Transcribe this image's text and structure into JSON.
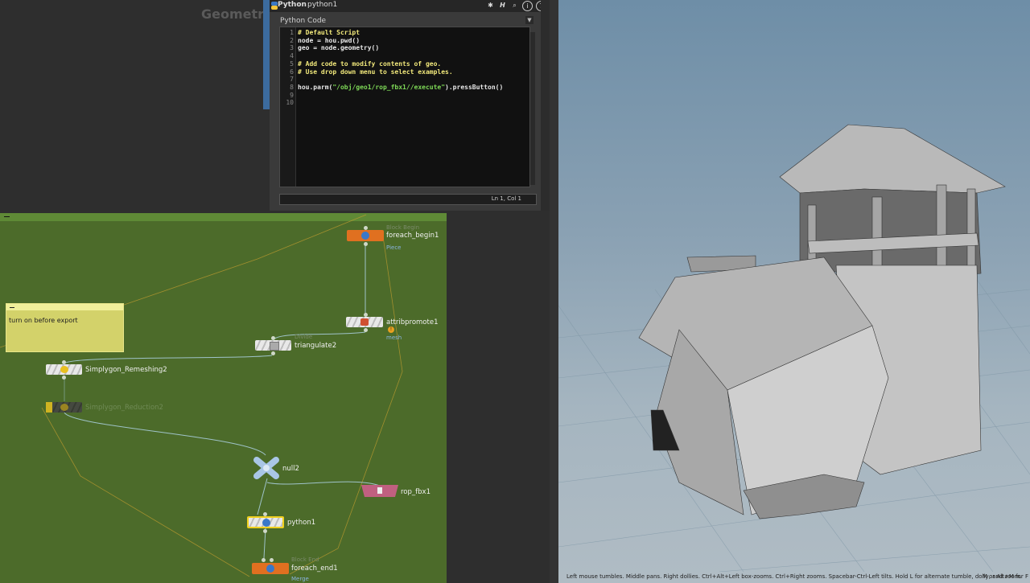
{
  "left_top": {
    "title": "Geometry"
  },
  "python_panel": {
    "tab_label": "Python",
    "node_name": "python1",
    "code_label": "Python Code",
    "lines": [
      {
        "n": "1",
        "text": "# Default Script",
        "kind": "comment"
      },
      {
        "n": "2",
        "text": "node = hou.pwd()",
        "kind": "code"
      },
      {
        "n": "3",
        "text": "geo = node.geometry()",
        "kind": "code"
      },
      {
        "n": "4",
        "text": "",
        "kind": "code"
      },
      {
        "n": "5",
        "text": "# Add code to modify contents of geo.",
        "kind": "comment"
      },
      {
        "n": "6",
        "text": "# Use drop down menu to select examples.",
        "kind": "comment"
      },
      {
        "n": "7",
        "text": "",
        "kind": "code"
      },
      {
        "n": "8",
        "pre": "hou.parm(",
        "str": "\"/obj/geo1/rop_fbx1//execute\"",
        "post": ").pressButton()",
        "kind": "mixed"
      },
      {
        "n": "9",
        "text": "",
        "kind": "code"
      },
      {
        "n": "10",
        "text": "",
        "kind": "code"
      }
    ],
    "status": "Ln 1, Col 1",
    "header_icons": [
      "gear-icon",
      "h-icon",
      "magnify-icon",
      "info-icon",
      "help-icon"
    ]
  },
  "network": {
    "sticky_note": "turn on before export",
    "nodes": {
      "foreach_begin1": {
        "label": "foreach_begin1",
        "faint": "Block Begin",
        "sub": "Piece"
      },
      "attribpromote1": {
        "label": "attribpromote1",
        "sub": "mesh"
      },
      "triangulate2": {
        "label": "triangulate2",
        "faint": "Divide"
      },
      "simplygon_remeshing2": {
        "label": "Simplygon_Remeshing2"
      },
      "simplygon_reduction2": {
        "label": "Simplygon_Reduction2"
      },
      "null2": {
        "label": "null2"
      },
      "rop_fbx1": {
        "label": "rop_fbx1"
      },
      "python1": {
        "label": "python1"
      },
      "foreach_end1": {
        "label": "foreach_end1",
        "faint": "Block End",
        "sub": "Merge"
      }
    }
  },
  "viewport": {
    "status": "Left mouse tumbles. Middle pans. Right dollies. Ctrl+Alt+Left box-zooms. Ctrl+Right zooms. Spacebar-Ctrl-Left tilts. Hold L for alternate tumble, dolly, and zoom.",
    "status_right": "M or Alt+M for F"
  },
  "colors": {
    "network_bg": "#4c6b2a",
    "sticky": "#d3d26a",
    "foreach_node": "#e07020",
    "rop_node": "#c06080",
    "code_comment": "#f1e87b",
    "code_string": "#7ed957"
  }
}
